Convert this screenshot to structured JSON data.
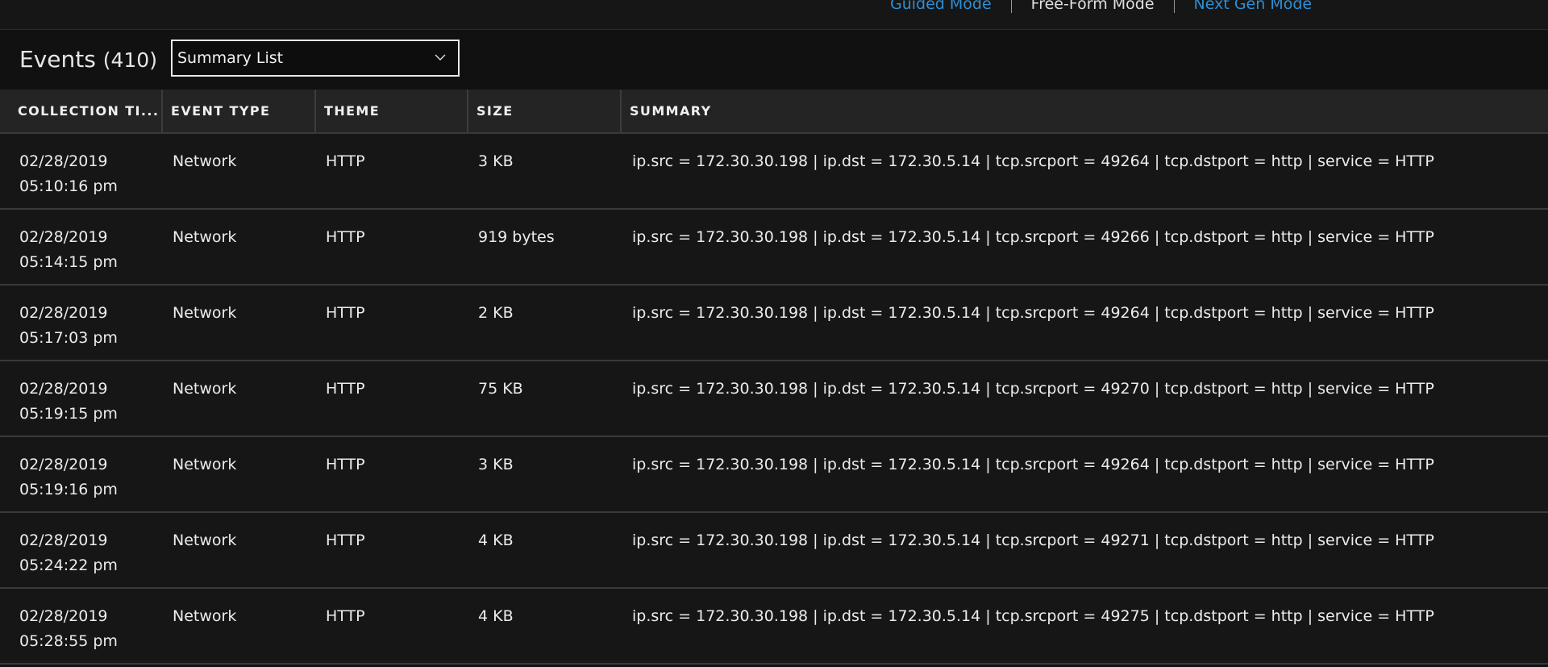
{
  "modes": [
    {
      "label": "Guided Mode",
      "active": false
    },
    {
      "label": "Free-Form Mode",
      "active": true
    },
    {
      "label": "Next Gen Mode",
      "active": false
    }
  ],
  "events": {
    "title": "Events",
    "count": "(410)",
    "view_select": {
      "value": "Summary List"
    }
  },
  "table": {
    "columns": [
      "COLLECTION TI...",
      "EVENT TYPE",
      "THEME",
      "SIZE",
      "SUMMARY"
    ],
    "rows": [
      {
        "date": "02/28/2019",
        "time": "05:10:16 pm",
        "event_type": "Network",
        "theme": "HTTP",
        "size": "3 KB",
        "summary": "ip.src = 172.30.30.198 | ip.dst = 172.30.5.14 | tcp.srcport = 49264 | tcp.dstport = http | service = HTTP"
      },
      {
        "date": "02/28/2019",
        "time": "05:14:15 pm",
        "event_type": "Network",
        "theme": "HTTP",
        "size": "919 bytes",
        "summary": "ip.src = 172.30.30.198 | ip.dst = 172.30.5.14 | tcp.srcport = 49266 | tcp.dstport = http | service = HTTP"
      },
      {
        "date": "02/28/2019",
        "time": "05:17:03 pm",
        "event_type": "Network",
        "theme": "HTTP",
        "size": "2 KB",
        "summary": "ip.src = 172.30.30.198 | ip.dst = 172.30.5.14 | tcp.srcport = 49264 | tcp.dstport = http | service = HTTP"
      },
      {
        "date": "02/28/2019",
        "time": "05:19:15 pm",
        "event_type": "Network",
        "theme": "HTTP",
        "size": "75 KB",
        "summary": "ip.src = 172.30.30.198 | ip.dst = 172.30.5.14 | tcp.srcport = 49270 | tcp.dstport = http | service = HTTP"
      },
      {
        "date": "02/28/2019",
        "time": "05:19:16 pm",
        "event_type": "Network",
        "theme": "HTTP",
        "size": "3 KB",
        "summary": "ip.src = 172.30.30.198 | ip.dst = 172.30.5.14 | tcp.srcport = 49264 | tcp.dstport = http | service = HTTP"
      },
      {
        "date": "02/28/2019",
        "time": "05:24:22 pm",
        "event_type": "Network",
        "theme": "HTTP",
        "size": "4 KB",
        "summary": "ip.src = 172.30.30.198 | ip.dst = 172.30.5.14 | tcp.srcport = 49271 | tcp.dstport = http | service = HTTP"
      },
      {
        "date": "02/28/2019",
        "time": "05:28:55 pm",
        "event_type": "Network",
        "theme": "HTTP",
        "size": "4 KB",
        "summary": "ip.src = 172.30.30.198 | ip.dst = 172.30.5.14 | tcp.srcport = 49275 | tcp.dstport = http | service = HTTP"
      }
    ]
  },
  "icons": {
    "dropdown": "chevron-down-icon"
  },
  "colors": {
    "background": "#101010",
    "link": "#2d8fd5",
    "header_row": "#242424",
    "row": "#161616",
    "divider": "#3a3a3a"
  }
}
